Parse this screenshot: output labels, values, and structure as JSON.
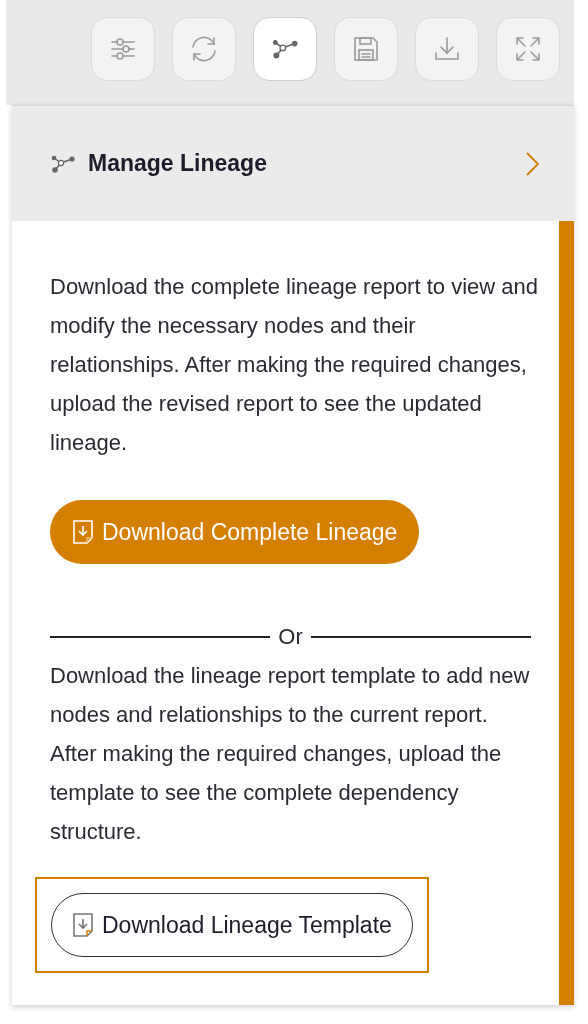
{
  "toolbar": [
    {
      "kind": "filters",
      "selected": false
    },
    {
      "kind": "refresh",
      "selected": false
    },
    {
      "kind": "lineage",
      "selected": true
    },
    {
      "kind": "save",
      "selected": false
    },
    {
      "kind": "download",
      "selected": false
    },
    {
      "kind": "expand",
      "selected": false
    }
  ],
  "panel": {
    "title": "Manage Lineage",
    "intro": "Download the complete lineage report to view and modify the necessary nodes and their relationships. After making the required changes, upload the revised report to see the updated lineage.",
    "primary_button": "Download Complete Lineage",
    "divider": "Or",
    "template_text": "Download the lineage report template to add new nodes and relationships to the current report. After making the required changes, upload the template to see the complete dependency structure.",
    "template_button": {
      "label": "Download Lineage Template",
      "focused": true
    }
  }
}
